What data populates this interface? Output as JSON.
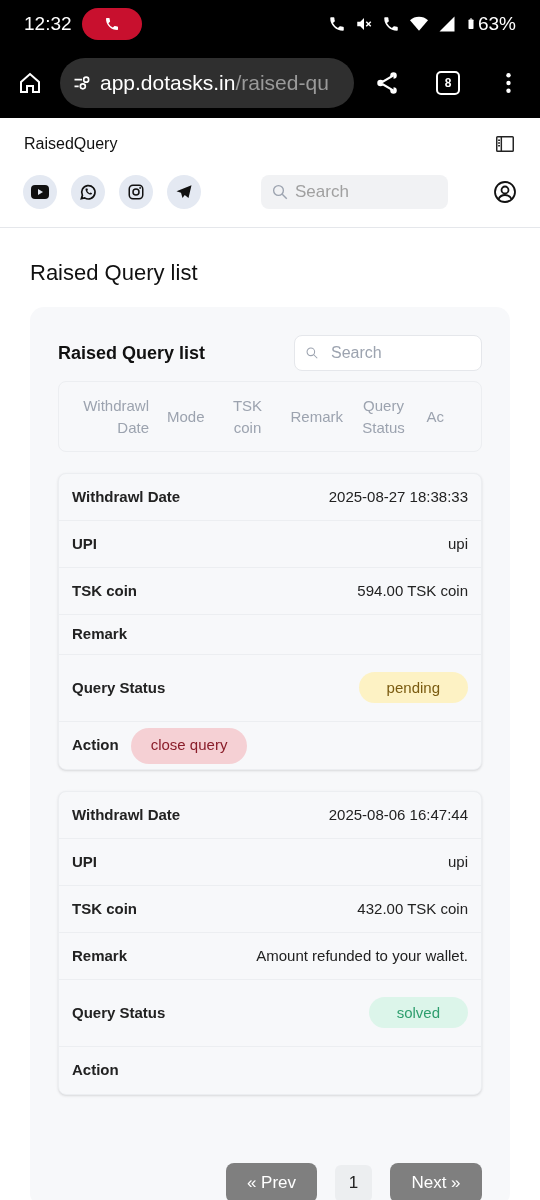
{
  "status_bar": {
    "time": "12:32",
    "battery": "63%"
  },
  "browser": {
    "url_host": "app.dotasks.in",
    "url_path": "/raised-qu",
    "tab_count": "8"
  },
  "header": {
    "title": "RaisedQuery",
    "search_placeholder": "Search"
  },
  "page_title": "Raised Query list",
  "panel": {
    "title": "Raised Query list",
    "search_placeholder": "Search",
    "columns": [
      {
        "label": "Withdrawl Date"
      },
      {
        "label": "Mode"
      },
      {
        "label": "TSK coin"
      },
      {
        "label": "Remark"
      },
      {
        "label": "Query Status"
      },
      {
        "label": "Ac"
      }
    ],
    "cards": [
      {
        "fields": [
          {
            "kind": "text",
            "label": "Withdrawl Date",
            "value": "2025-08-27 18:38:33"
          },
          {
            "kind": "text",
            "label": "UPI",
            "value": "upi"
          },
          {
            "kind": "text",
            "label": "TSK coin",
            "value": "594.00 TSK coin"
          },
          {
            "kind": "text",
            "label": "Remark"
          },
          {
            "kind": "status",
            "label": "Query Status",
            "status": "pending"
          },
          {
            "kind": "action",
            "label": "Action",
            "value": "close query"
          }
        ]
      },
      {
        "fields": [
          {
            "kind": "text",
            "label": "Withdrawl Date",
            "value": "2025-08-06 16:47:44"
          },
          {
            "kind": "text",
            "label": "UPI",
            "value": "upi"
          },
          {
            "kind": "text",
            "label": "TSK coin",
            "value": "432.00 TSK coin"
          },
          {
            "kind": "text",
            "label": "Remark",
            "value": "Amount refunded to your wallet."
          },
          {
            "kind": "status",
            "label": "Query Status",
            "status": "solved"
          },
          {
            "kind": "action",
            "label": "Action"
          }
        ]
      }
    ],
    "pagination": {
      "prev": "« Prev",
      "page": "1",
      "next": "Next »"
    }
  }
}
